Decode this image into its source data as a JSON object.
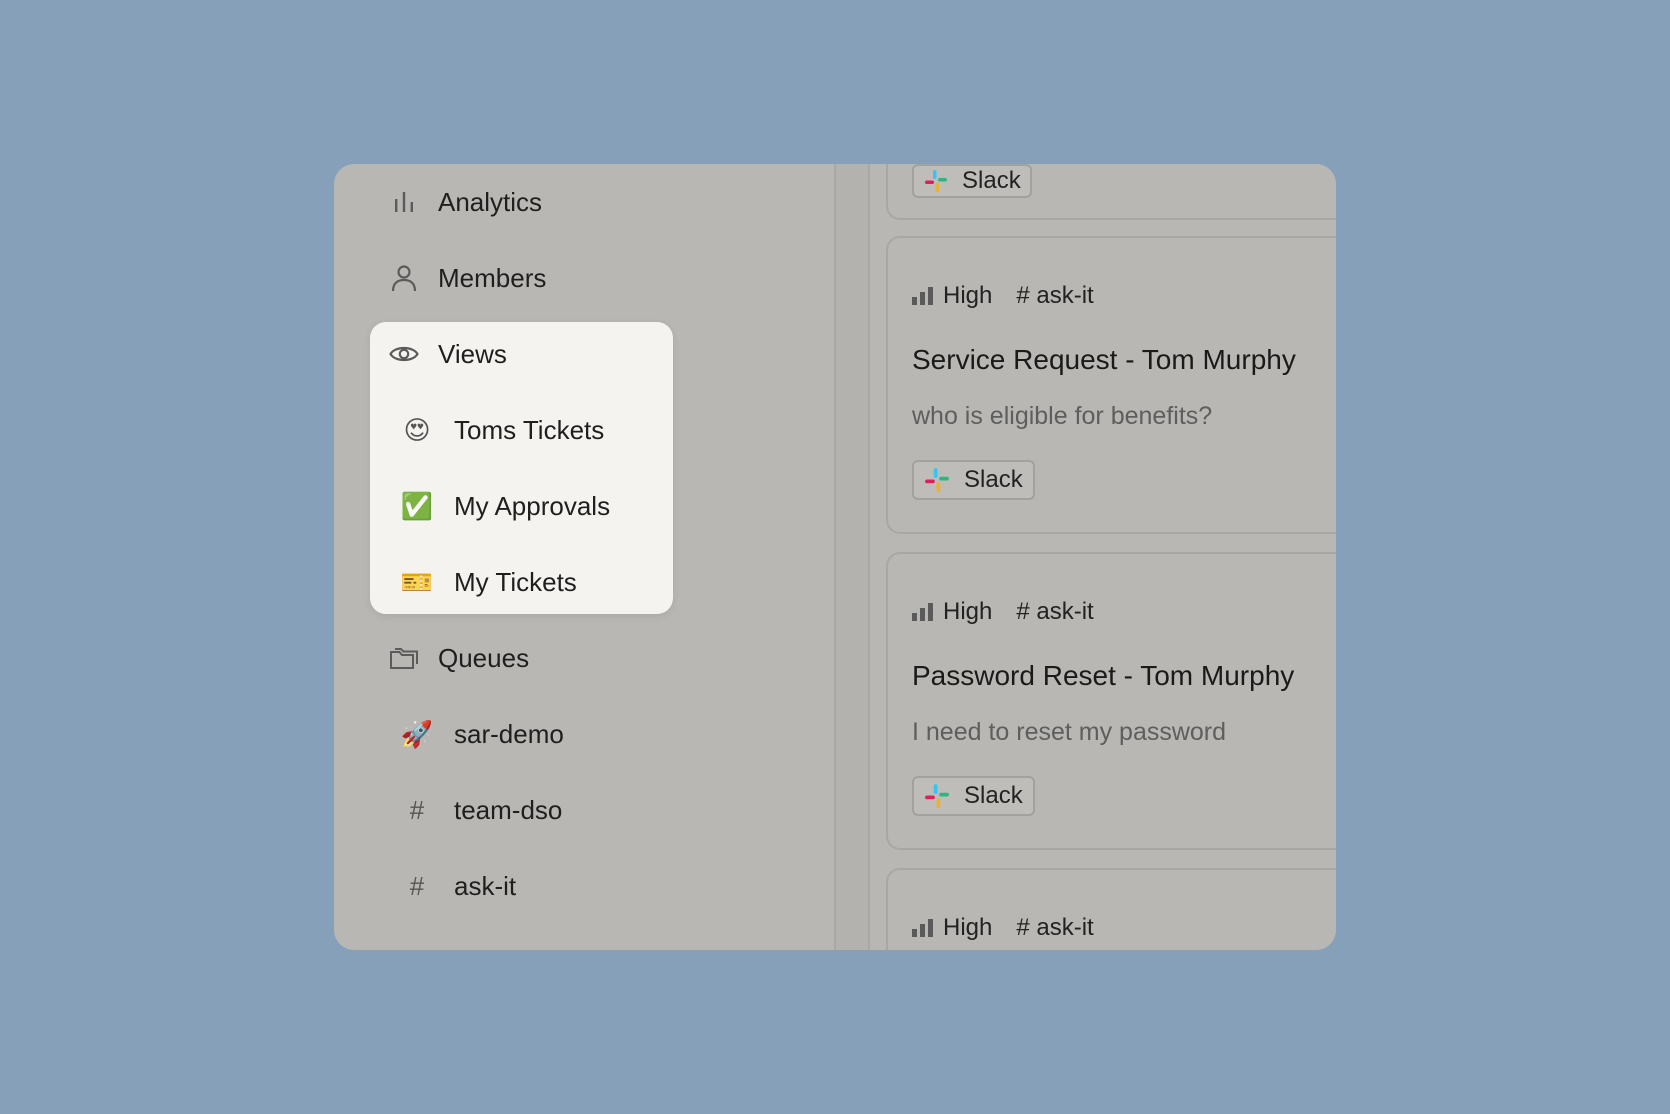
{
  "sidebar": {
    "items": [
      {
        "label": "Analytics",
        "icon": "bar-chart-icon"
      },
      {
        "label": "Members",
        "icon": "person-icon"
      },
      {
        "label": "Views",
        "icon": "eye-icon"
      },
      {
        "label": "Queues",
        "icon": "folders-icon"
      }
    ],
    "views": [
      {
        "label": "Toms Tickets",
        "emoji": "😍"
      },
      {
        "label": "My Approvals",
        "emoji": "✅"
      },
      {
        "label": "My Tickets",
        "emoji": "🎫"
      }
    ],
    "queues": [
      {
        "label": "sar-demo",
        "emoji": "🚀"
      },
      {
        "label": "team-dso",
        "emoji": "#"
      },
      {
        "label": "ask-it",
        "emoji": "#"
      }
    ]
  },
  "tickets": [
    {
      "source": "Slack"
    },
    {
      "priority": "High",
      "channel": "# ask-it",
      "title": "Service Request - Tom Murphy",
      "description": "who is eligible for benefits?",
      "source": "Slack"
    },
    {
      "priority": "High",
      "channel": "# ask-it",
      "title": "Password Reset - Tom Murphy",
      "description": "I need to reset my password",
      "source": "Slack"
    },
    {
      "priority": "High",
      "channel": "# ask-it"
    }
  ],
  "colors": {
    "background": "#86a0b9",
    "panel": "#b8b7b3",
    "highlight": "#f4f3ef"
  }
}
